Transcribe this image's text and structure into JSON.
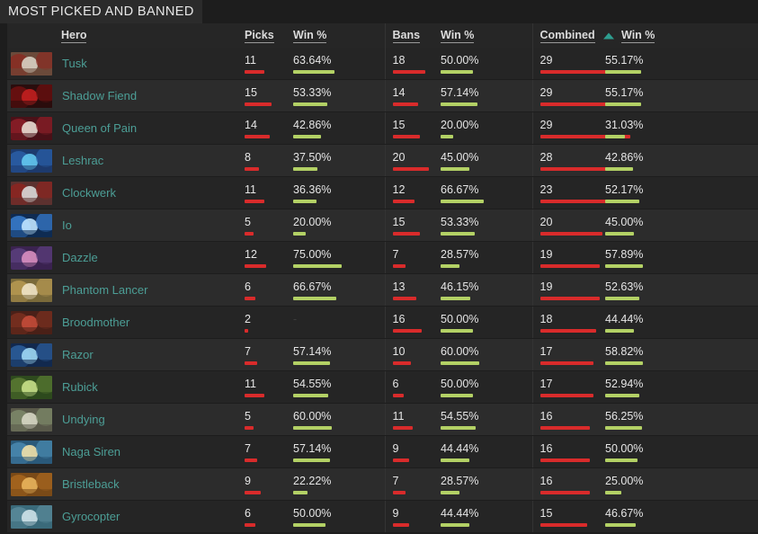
{
  "panel": {
    "title": "MOST PICKED AND BANNED"
  },
  "colors": {
    "accent_teal": "#4c9e96",
    "sort_arrow": "#2e9e8f",
    "bar_red": "#d92b2b",
    "bar_green": "#b3d165",
    "text": "#e6e6e6",
    "row_odd": "#252525",
    "row_even": "#2c2c2c",
    "header_bg": "#262626",
    "page_bg": "#1d1d1d"
  },
  "table": {
    "columns": [
      {
        "key": "hero",
        "label": "Hero",
        "sorted": false
      },
      {
        "key": "picks",
        "label": "Picks",
        "sorted": false
      },
      {
        "key": "pick_win",
        "label": "Win %",
        "sorted": false
      },
      {
        "key": "bans",
        "label": "Bans",
        "sorted": false
      },
      {
        "key": "ban_win",
        "label": "Win %",
        "sorted": false
      },
      {
        "key": "combined",
        "label": "Combined",
        "sorted": true
      },
      {
        "key": "comb_win",
        "label": "Win %",
        "sorted": false
      }
    ],
    "sort": {
      "column": "Combined",
      "direction": "asc",
      "indicator": "sort-ascending-triangle"
    },
    "max": {
      "picks": 20,
      "bans": 20,
      "combined": 29
    },
    "rows": [
      {
        "hero": "Tusk",
        "picks": 11,
        "pick_win": "63.64%",
        "pick_win_val": 63.64,
        "bans": 18,
        "ban_win": "50.00%",
        "ban_win_val": 50.0,
        "combined": 29,
        "comb_win": "55.17%",
        "comb_win_val": 55.17
      },
      {
        "hero": "Shadow Fiend",
        "picks": 15,
        "pick_win": "53.33%",
        "pick_win_val": 53.33,
        "bans": 14,
        "ban_win": "57.14%",
        "ban_win_val": 57.14,
        "combined": 29,
        "comb_win": "55.17%",
        "comb_win_val": 55.17
      },
      {
        "hero": "Queen of Pain",
        "picks": 14,
        "pick_win": "42.86%",
        "pick_win_val": 42.86,
        "bans": 15,
        "ban_win": "20.00%",
        "ban_win_val": 20.0,
        "combined": 29,
        "comb_win": "31.03%",
        "comb_win_val": 31.03
      },
      {
        "hero": "Leshrac",
        "picks": 8,
        "pick_win": "37.50%",
        "pick_win_val": 37.5,
        "bans": 20,
        "ban_win": "45.00%",
        "ban_win_val": 45.0,
        "combined": 28,
        "comb_win": "42.86%",
        "comb_win_val": 42.86
      },
      {
        "hero": "Clockwerk",
        "picks": 11,
        "pick_win": "36.36%",
        "pick_win_val": 36.36,
        "bans": 12,
        "ban_win": "66.67%",
        "ban_win_val": 66.67,
        "combined": 23,
        "comb_win": "52.17%",
        "comb_win_val": 52.17
      },
      {
        "hero": "Io",
        "picks": 5,
        "pick_win": "20.00%",
        "pick_win_val": 20.0,
        "bans": 15,
        "ban_win": "53.33%",
        "ban_win_val": 53.33,
        "combined": 20,
        "comb_win": "45.00%",
        "comb_win_val": 45.0
      },
      {
        "hero": "Dazzle",
        "picks": 12,
        "pick_win": "75.00%",
        "pick_win_val": 75.0,
        "bans": 7,
        "ban_win": "28.57%",
        "ban_win_val": 28.57,
        "combined": 19,
        "comb_win": "57.89%",
        "comb_win_val": 57.89
      },
      {
        "hero": "Phantom Lancer",
        "picks": 6,
        "pick_win": "66.67%",
        "pick_win_val": 66.67,
        "bans": 13,
        "ban_win": "46.15%",
        "ban_win_val": 46.15,
        "combined": 19,
        "comb_win": "52.63%",
        "comb_win_val": 52.63
      },
      {
        "hero": "Broodmother",
        "picks": 2,
        "pick_win": "-",
        "pick_win_val": 0,
        "bans": 16,
        "ban_win": "50.00%",
        "ban_win_val": 50.0,
        "combined": 18,
        "comb_win": "44.44%",
        "comb_win_val": 44.44
      },
      {
        "hero": "Razor",
        "picks": 7,
        "pick_win": "57.14%",
        "pick_win_val": 57.14,
        "bans": 10,
        "ban_win": "60.00%",
        "ban_win_val": 60.0,
        "combined": 17,
        "comb_win": "58.82%",
        "comb_win_val": 58.82
      },
      {
        "hero": "Rubick",
        "picks": 11,
        "pick_win": "54.55%",
        "pick_win_val": 54.55,
        "bans": 6,
        "ban_win": "50.00%",
        "ban_win_val": 50.0,
        "combined": 17,
        "comb_win": "52.94%",
        "comb_win_val": 52.94
      },
      {
        "hero": "Undying",
        "picks": 5,
        "pick_win": "60.00%",
        "pick_win_val": 60.0,
        "bans": 11,
        "ban_win": "54.55%",
        "ban_win_val": 54.55,
        "combined": 16,
        "comb_win": "56.25%",
        "comb_win_val": 56.25
      },
      {
        "hero": "Naga Siren",
        "picks": 7,
        "pick_win": "57.14%",
        "pick_win_val": 57.14,
        "bans": 9,
        "ban_win": "44.44%",
        "ban_win_val": 44.44,
        "combined": 16,
        "comb_win": "50.00%",
        "comb_win_val": 50.0
      },
      {
        "hero": "Bristleback",
        "picks": 9,
        "pick_win": "22.22%",
        "pick_win_val": 22.22,
        "bans": 7,
        "ban_win": "28.57%",
        "ban_win_val": 28.57,
        "combined": 16,
        "comb_win": "25.00%",
        "comb_win_val": 25.0
      },
      {
        "hero": "Gyrocopter",
        "picks": 6,
        "pick_win": "50.00%",
        "pick_win_val": 50.0,
        "bans": 9,
        "ban_win": "44.44%",
        "ban_win_val": 44.44,
        "combined": 15,
        "comb_win": "46.67%",
        "comb_win_val": 46.67
      }
    ]
  },
  "portraits": {
    "Tusk": {
      "bg": "#6b4a3a",
      "a": "#d8d2c4",
      "b": "#8a2b22"
    },
    "Shadow Fiend": {
      "bg": "#2a0d0d",
      "a": "#c21f1f",
      "b": "#701010"
    },
    "Queen of Pain": {
      "bg": "#4a1118",
      "a": "#e8dcd2",
      "b": "#8d1f28"
    },
    "Leshrac": {
      "bg": "#1d3b6e",
      "a": "#63c8f0",
      "b": "#2a5fa8"
    },
    "Clockwerk": {
      "bg": "#5c3230",
      "a": "#d9d9d9",
      "b": "#8d2420"
    },
    "Io": {
      "bg": "#0f2b52",
      "a": "#bfe4ff",
      "b": "#3a7fd0"
    },
    "Dazzle": {
      "bg": "#3b2350",
      "a": "#d98fc0",
      "b": "#5c3f7e"
    },
    "Phantom Lancer": {
      "bg": "#7a6a3a",
      "a": "#efe4c8",
      "b": "#b89a52"
    },
    "Broodmother": {
      "bg": "#4a2018",
      "a": "#c44b38",
      "b": "#7a3020"
    },
    "Razor": {
      "bg": "#12294e",
      "a": "#9fd8f5",
      "b": "#2d5f9e"
    },
    "Rubick": {
      "bg": "#2e4a1e",
      "a": "#c8e08a",
      "b": "#5a7a32"
    },
    "Undying": {
      "bg": "#5a5a4a",
      "a": "#d6d6c4",
      "b": "#7e8a6a"
    },
    "Naga Siren": {
      "bg": "#2a5a7a",
      "a": "#f0e0a8",
      "b": "#4a8ab0"
    },
    "Bristleback": {
      "bg": "#7a4a18",
      "a": "#e8b45c",
      "b": "#a8661f"
    },
    "Gyrocopter": {
      "bg": "#3a6a7a",
      "a": "#cfe2e8",
      "b": "#5a8a9a"
    }
  }
}
